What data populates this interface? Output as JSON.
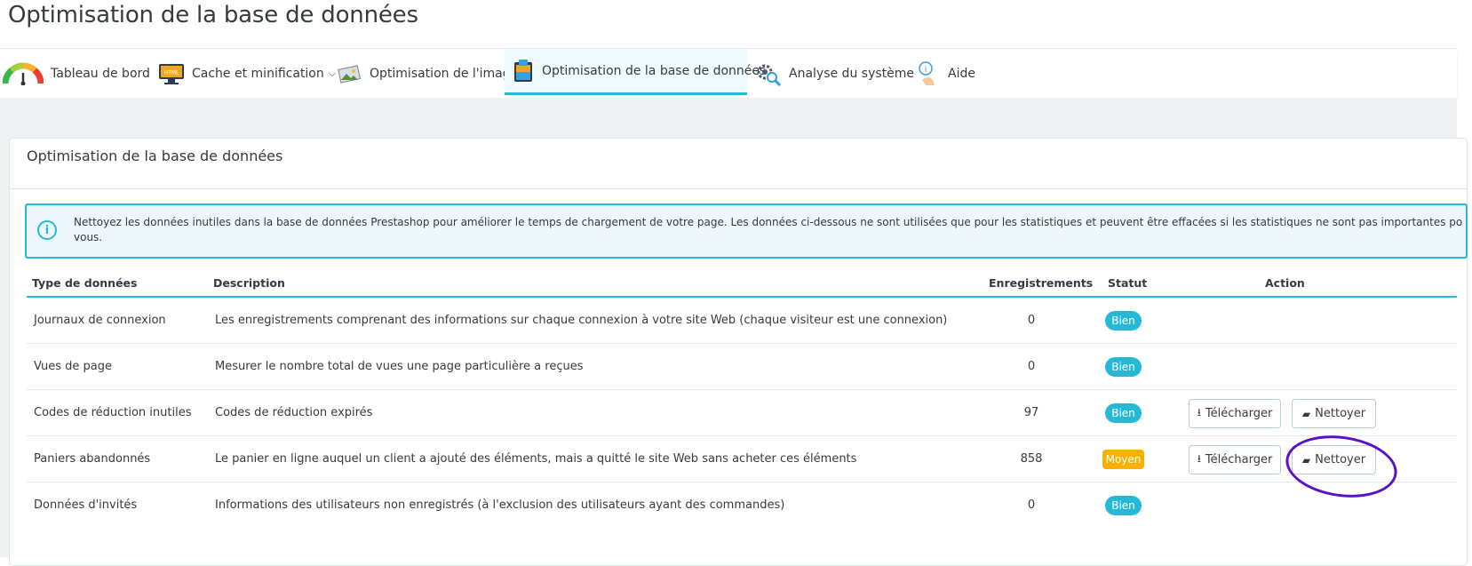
{
  "page": {
    "title": "Optimisation de la base de données"
  },
  "tabs": [
    {
      "label": "Tableau de bord",
      "icon": "gauge-icon"
    },
    {
      "label": "Cache et minification",
      "icon": "monitor-html-icon",
      "has_dropdown": true
    },
    {
      "label": "Optimisation de l'image",
      "icon": "image-icon"
    },
    {
      "label": "Optimisation de la base de données",
      "icon": "database-icon",
      "active": true
    },
    {
      "label": "Analyse du système",
      "icon": "gear-search-icon"
    },
    {
      "label": "Aide",
      "icon": "help-icon"
    }
  ],
  "card": {
    "title": "Optimisation de la base de données",
    "info_line1": "Nettoyez les données inutiles dans la base de données Prestashop pour améliorer le temps de chargement de votre page. Les données ci-dessous ne sont utilisées que pour les statistiques et peuvent être effacées si les statistiques ne sont pas importantes po",
    "info_line2": "vous."
  },
  "table": {
    "headers": {
      "type": "Type de données",
      "description": "Description",
      "records": "Enregistrements",
      "status": "Statut",
      "action": "Action"
    },
    "rows": [
      {
        "type": "Journaux de connexion",
        "description": "Les enregistrements comprenant des informations sur chaque connexion à votre site Web (chaque visiteur est une connexion)",
        "records": "0",
        "status": "Bien",
        "status_color": "#25b9d7"
      },
      {
        "type": "Vues de page",
        "description": "Mesurer le nombre total de vues une page particulière a reçues",
        "records": "0",
        "status": "Bien",
        "status_color": "#25b9d7"
      },
      {
        "type": "Codes de réduction inutiles",
        "description": "Codes de réduction expirés",
        "records": "97",
        "status": "Bien",
        "status_color": "#25b9d7",
        "download_label": "Télécharger",
        "clean_label": "Nettoyer"
      },
      {
        "type": "Paniers abandonnés",
        "description": "Le panier en ligne auquel un client a ajouté des éléments, mais a quitté le site Web sans acheter ces éléments",
        "records": "858",
        "status": "Moyen",
        "status_color": "#fab000",
        "download_label": "Télécharger",
        "clean_label": "Nettoyer"
      },
      {
        "type": "Données d'invités",
        "description": "Informations des utilisateurs non enregistrés (à l'exclusion des utilisateurs ayant des commandes)",
        "records": "0",
        "status": "Bien",
        "status_color": "#25b9d7"
      }
    ]
  },
  "colors": {
    "accent": "#25b9d7",
    "warning": "#fab000",
    "annotation": "#5a0fc8"
  }
}
